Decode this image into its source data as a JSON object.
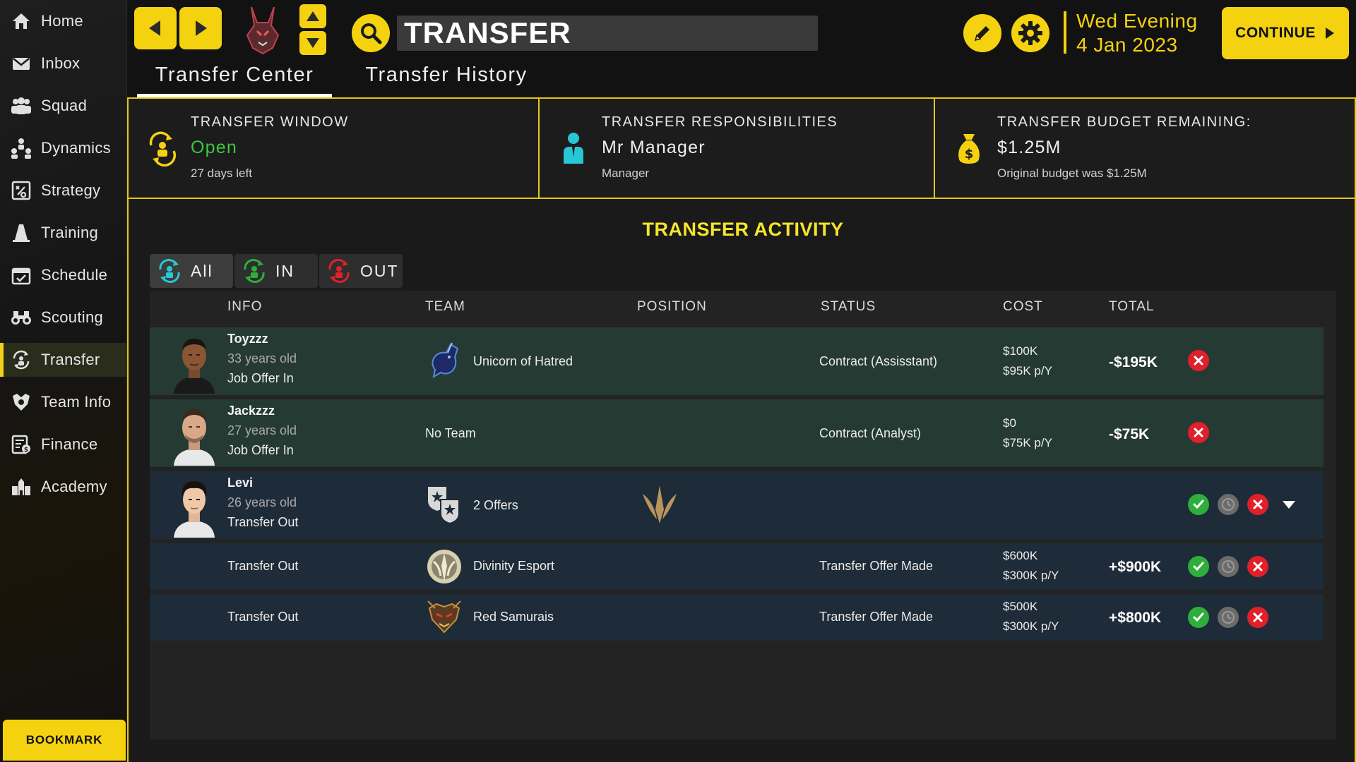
{
  "sidebar": {
    "items": [
      {
        "label": "Home",
        "icon": "home-icon"
      },
      {
        "label": "Inbox",
        "icon": "mail-icon"
      },
      {
        "label": "Squad",
        "icon": "squad-icon"
      },
      {
        "label": "Dynamics",
        "icon": "dynamics-icon"
      },
      {
        "label": "Strategy",
        "icon": "strategy-icon"
      },
      {
        "label": "Training",
        "icon": "training-cone-icon"
      },
      {
        "label": "Schedule",
        "icon": "calendar-icon"
      },
      {
        "label": "Scouting",
        "icon": "binoculars-icon"
      },
      {
        "label": "Transfer",
        "icon": "transfer-icon",
        "active": true
      },
      {
        "label": "Team Info",
        "icon": "team-crest-icon"
      },
      {
        "label": "Finance",
        "icon": "finance-icon"
      },
      {
        "label": "Academy",
        "icon": "academy-icon"
      }
    ],
    "bookmark_label": "BOOKMARK"
  },
  "header": {
    "title": "TRANSFER",
    "date_line1": "Wed  Evening",
    "date_line2": "4 Jan 2023",
    "continue_label": "CONTINUE"
  },
  "tabs": [
    {
      "label": "Transfer Center",
      "active": true
    },
    {
      "label": "Transfer History",
      "active": false
    }
  ],
  "cards": {
    "window": {
      "title": "TRANSFER WINDOW",
      "value": "Open",
      "sub": "27 days left"
    },
    "responsibilities": {
      "title": "TRANSFER RESPONSIBILITIES",
      "value": "Mr Manager",
      "sub": "Manager"
    },
    "budget": {
      "title": "TRANSFER BUDGET REMAINING:",
      "value": "$1.25M",
      "sub": "Original budget was $1.25M"
    }
  },
  "activity": {
    "title": "TRANSFER ACTIVITY",
    "filters": [
      {
        "label": "All",
        "active": true
      },
      {
        "label": "IN",
        "active": false
      },
      {
        "label": "OUT",
        "active": false
      }
    ],
    "columns": {
      "info": "INFO",
      "team": "TEAM",
      "position": "POSITION",
      "status": "STATUS",
      "cost": "COST",
      "total": "TOTAL"
    },
    "rows": [
      {
        "name": "Toyzzz",
        "age": "33 years old",
        "role": "Job Offer In",
        "team": "Unicorn of Hatred",
        "status": "Contract (Assisstant)",
        "cost": "$100K",
        "wage": "$95K p/Y",
        "total": "-$195K"
      },
      {
        "name": "Jackzzz",
        "age": "27 years old",
        "role": "Job Offer In",
        "team": "No Team",
        "status": "Contract (Analyst)",
        "cost": "$0",
        "wage": "$75K p/Y",
        "total": "-$75K"
      },
      {
        "name": "Levi",
        "age": "26 years old",
        "role": "Transfer Out",
        "team": "2 Offers"
      },
      {
        "role": "Transfer Out",
        "team": "Divinity Esport",
        "status": "Transfer Offer Made",
        "cost": "$600K",
        "wage": "$300K p/Y",
        "total": "+$900K"
      },
      {
        "role": "Transfer Out",
        "team": "Red Samurais",
        "status": "Transfer Offer Made",
        "cost": "$500K",
        "wage": "$300K p/Y",
        "total": "+$800K"
      }
    ]
  },
  "colors": {
    "accent": "#f5d20f",
    "open": "#3cc93c",
    "title_yellow": "#f5e62a",
    "row_green": "#253a33",
    "row_blue": "#1e2b38",
    "accept": "#2fae3d",
    "reject": "#e0202a"
  }
}
